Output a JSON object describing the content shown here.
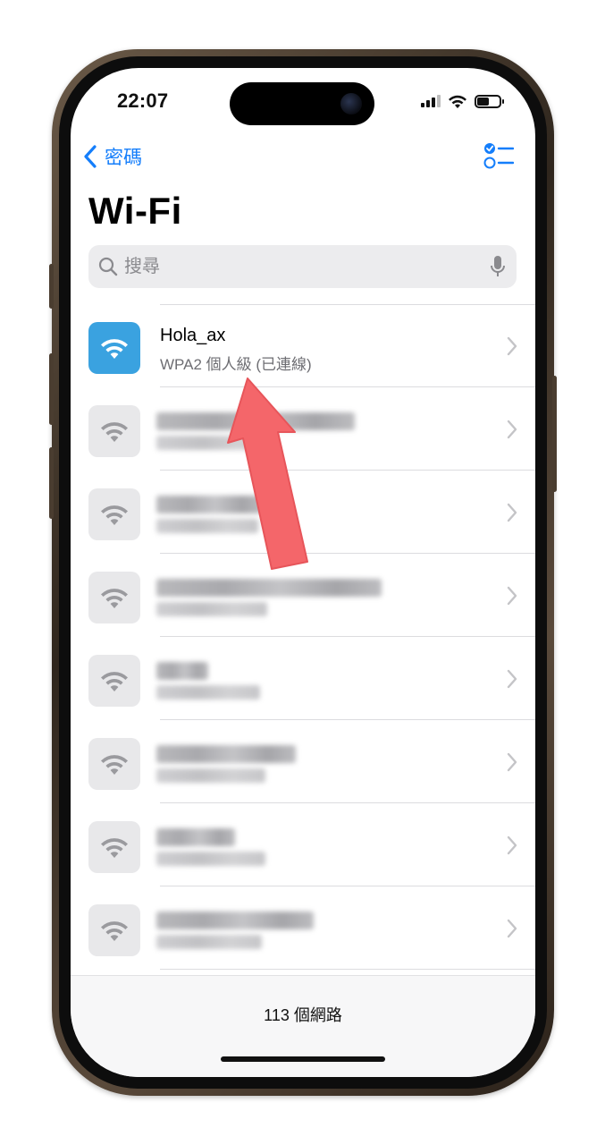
{
  "status_bar": {
    "time": "22:07",
    "signal_bars": 3,
    "battery_level": 0.55
  },
  "nav": {
    "back_label": "密碼",
    "back_icon": "chevron-left-icon",
    "select_icon": "checklist-icon"
  },
  "page": {
    "title": "Wi-Fi"
  },
  "search": {
    "placeholder": "搜尋",
    "value": ""
  },
  "networks": [
    {
      "name": "Hola_ax",
      "detail": "WPA2 個人級 (已連線)",
      "connected": true
    },
    {
      "name": "",
      "detail": "",
      "connected": false,
      "obscured": true
    },
    {
      "name": "",
      "detail": "",
      "connected": false,
      "obscured": true
    },
    {
      "name": "",
      "detail": "",
      "connected": false,
      "obscured": true
    },
    {
      "name": "",
      "detail": "",
      "connected": false,
      "obscured": true
    },
    {
      "name": "",
      "detail": "",
      "connected": false,
      "obscured": true
    },
    {
      "name": "",
      "detail": "",
      "connected": false,
      "obscured": true
    },
    {
      "name": "",
      "detail": "",
      "connected": false,
      "obscured": true
    }
  ],
  "footer": {
    "network_count": "113 個網路"
  },
  "colors": {
    "accent": "#147efb",
    "connected_icon_bg": "#3aa2e0",
    "annotation_arrow": "#f4666a"
  }
}
